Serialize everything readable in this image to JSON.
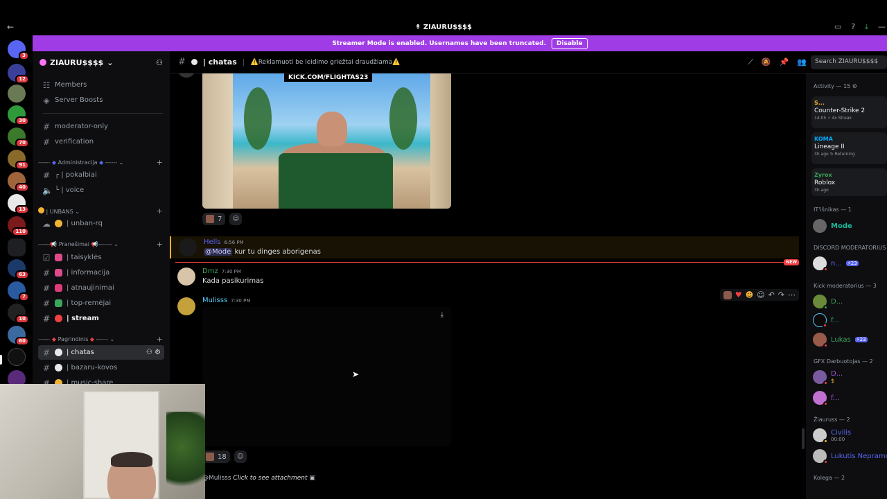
{
  "window": {
    "title": "ZIAURU$$$$",
    "back_icon": "←",
    "ticons": [
      "▭",
      "?",
      "⤓",
      "—"
    ]
  },
  "banner": {
    "text": "Streamer Mode is enabled. Usernames have been truncated.",
    "button": "Disable"
  },
  "rail": {
    "badges": [
      "3",
      "12",
      "30",
      "70",
      "91",
      "40",
      "13",
      "110",
      "63",
      "7",
      "10",
      "60"
    ]
  },
  "sidebar": {
    "server_name": "ZIAURU$$$$",
    "top_items": [
      "Members",
      "Server Boosts"
    ],
    "channels1": [
      "moderator-only",
      "verification"
    ],
    "cat_admin": "Administracija",
    "admin_channels": [
      "┌ | pokalbiai",
      "└ | voice"
    ],
    "cat_unbans": "| UNBANS",
    "unbans_channels": [
      "| unban-rq"
    ],
    "cat_pranesimai": "Pranešimai",
    "pranesimai_channels": [
      "| taisyklės",
      "| informacija",
      "| atnaujinimai",
      "| top-remėjai",
      "| stream"
    ],
    "cat_pagrindinis": "Pagrindinis",
    "pagrindinis_channels": [
      "| chatas",
      "| bazaru-kovos",
      "| music-share"
    ]
  },
  "header": {
    "channel": "| chatas",
    "topic": "⚠️Reklamuoti be leidimo griežtai draudžiama⚠️",
    "search_placeholder": "Search ZIAURU$$$$"
  },
  "messages": {
    "image_overlay_text": "KICK.COM/FLIGHTAS23",
    "reaction1_count": "7",
    "m1": {
      "user": "Hells",
      "time": "6:56 PM",
      "mention": "@Mode",
      "text": "kur tu dinges aborigenas"
    },
    "new_badge": "NEW",
    "m2": {
      "user": "Dmz",
      "time": "7:30 PM",
      "text": "Kada pasikurimas"
    },
    "m3": {
      "user": "Mulisss",
      "time": "7:30 PM"
    },
    "reaction2_count": "18",
    "reply": {
      "mention": "@Mulisss",
      "text": "Click to see attachment"
    }
  },
  "members": {
    "activity_header": "Activity — 15",
    "activities": [
      {
        "name": "S...",
        "game": "Counter-Strike 2",
        "meta": "14:05  ⚡ 4x Streak"
      },
      {
        "name": "KOMA",
        "game": "Lineage II",
        "meta": "3h ago  ↻ Returning"
      },
      {
        "name": "Zyrox",
        "game": "Roblox",
        "meta": "3h ago"
      }
    ],
    "role_it": "IT'išnikas — 1",
    "it_member": "Mode",
    "role_discord_mod": "DISCORD MODERATORIUS",
    "discord_mod_member": "n...",
    "discord_mod_tag": "⚡23",
    "role_kick_mod": "Kick moderatorius — 3",
    "kick_members": [
      "D...",
      "f...",
      "Lukas"
    ],
    "kick_tag": "⚡23",
    "role_gfx": "GFX Darbuotojas — 2",
    "gfx_members": [
      "D...",
      "f..."
    ],
    "gfx_sub": "$",
    "role_ziauruss": "Žiauruss — 2",
    "ziauruss_members": [
      "Civilis",
      "Lukutis Nepramu"
    ],
    "civilis_sub": "00:00",
    "role_kolega": "Kolega — 2"
  },
  "colors": {
    "accent": "#a03ce6",
    "mention": "#f0b232",
    "online_red": "#f23f43"
  }
}
